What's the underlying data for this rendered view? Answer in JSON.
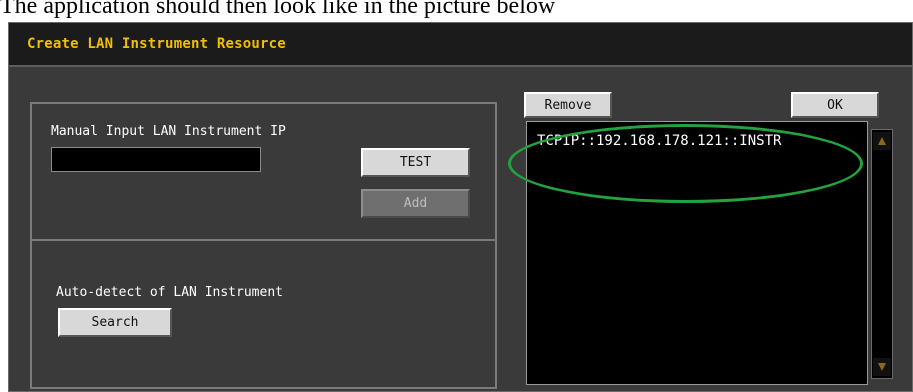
{
  "caption": {
    "text": "The application should then look like in the picture below"
  },
  "dialog": {
    "title": "Create LAN Instrument Resource",
    "manual": {
      "label": "Manual Input LAN Instrument IP",
      "ip_value": "",
      "test_label": "TEST",
      "add_label": "Add"
    },
    "auto": {
      "label": "Auto-detect of LAN Instrument",
      "search_label": "Search"
    },
    "resources": {
      "remove_label": "Remove",
      "ok_label": "OK",
      "items": [
        "TCPIP::192.168.178.121::INSTR"
      ]
    }
  },
  "colors": {
    "title": "#f0c000",
    "highlight": "#22a33f",
    "scroll_arrow": "#8a6a1a"
  }
}
